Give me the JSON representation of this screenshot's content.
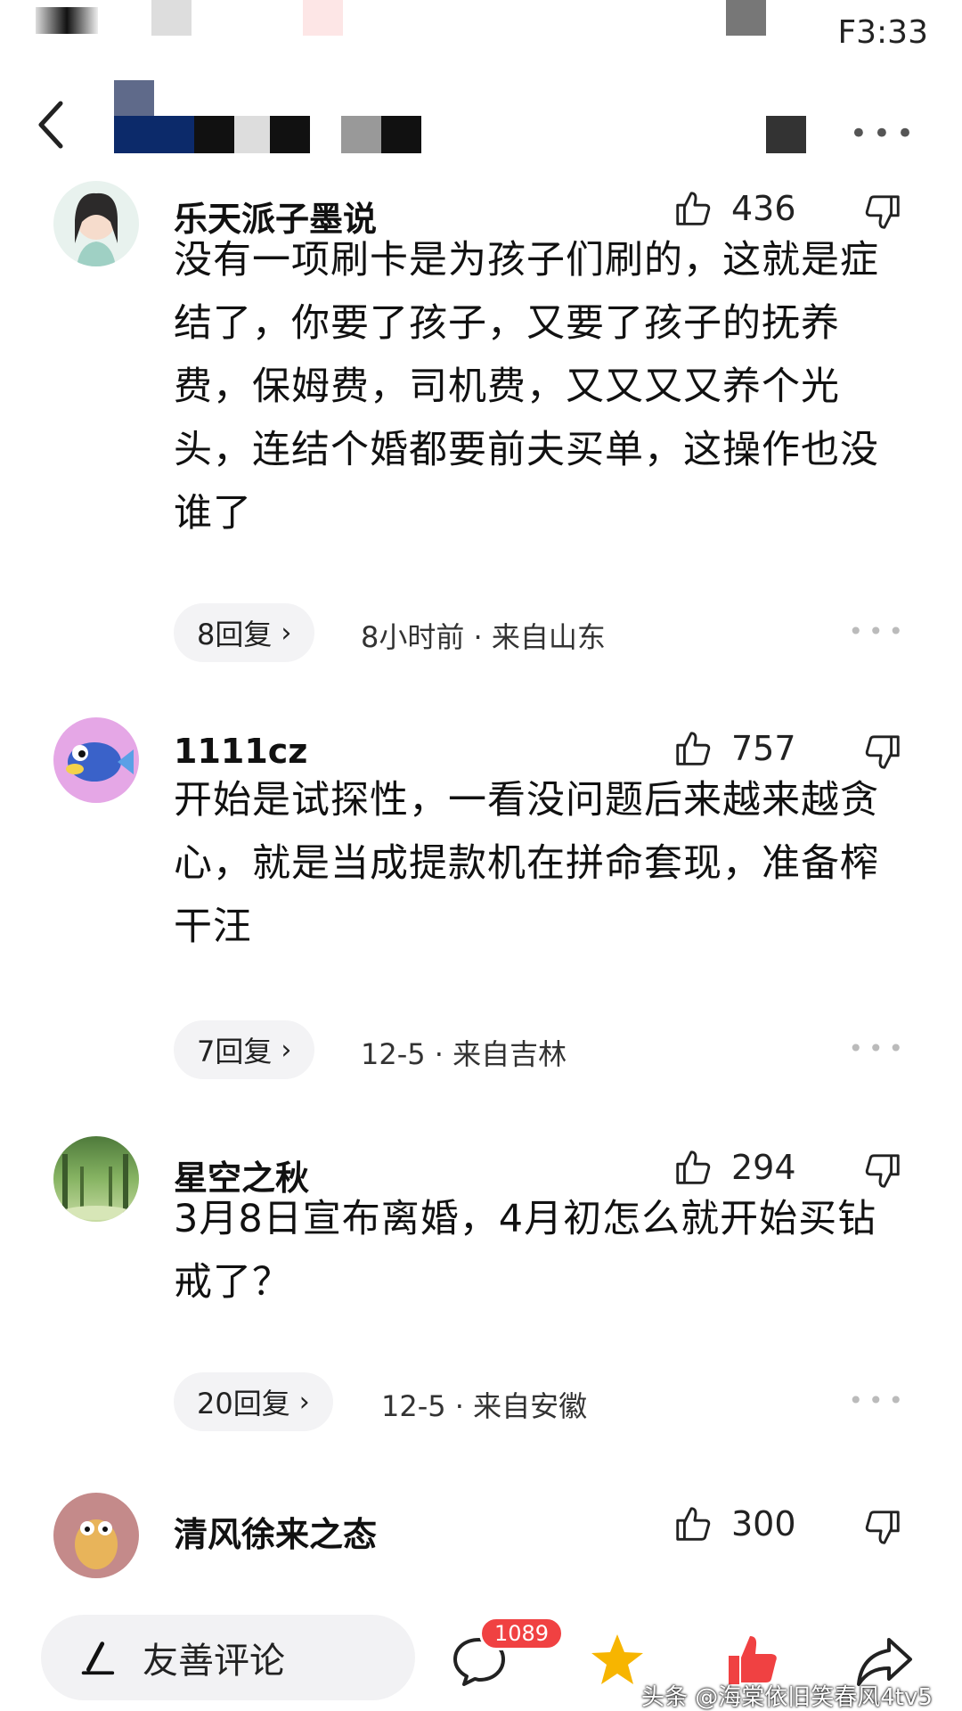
{
  "status_bar": {
    "time": "F3:33"
  },
  "comments": [
    {
      "username": "乐天派子墨说",
      "likes": "436",
      "text": "没有一项刷卡是为孩子们刷的，这就是症结了，你要了孩子，又要了孩子的抚养费，保姆费，司机费，又又又又养个光头，连结个婚都要前夫买单，这操作也没谁了",
      "replies": "8回复",
      "meta": "8小时前 · 来自山东"
    },
    {
      "username": "1111cz",
      "likes": "757",
      "text": "开始是试探性，一看没问题后来越来越贪心，就是当成提款机在拼命套现，准备榨干汪",
      "replies": "7回复",
      "meta": "12-5 · 来自吉林"
    },
    {
      "username": "星空之秋",
      "likes": "294",
      "text": "3月8日宣布离婚，4月初怎么就开始买钻戒了？",
      "replies": "20回复",
      "meta": "12-5 · 来自安徽"
    },
    {
      "username": "清风徐来之态",
      "likes": "300"
    }
  ],
  "bottom_bar": {
    "comment_placeholder": "友善评论",
    "comment_count_badge": "1089"
  },
  "watermark": "头条 @海棠依旧笑春风4tv5",
  "colors": {
    "accent_red": "#f04142",
    "star_yellow": "#f7b500",
    "pill_bg": "#f3f3f5"
  }
}
